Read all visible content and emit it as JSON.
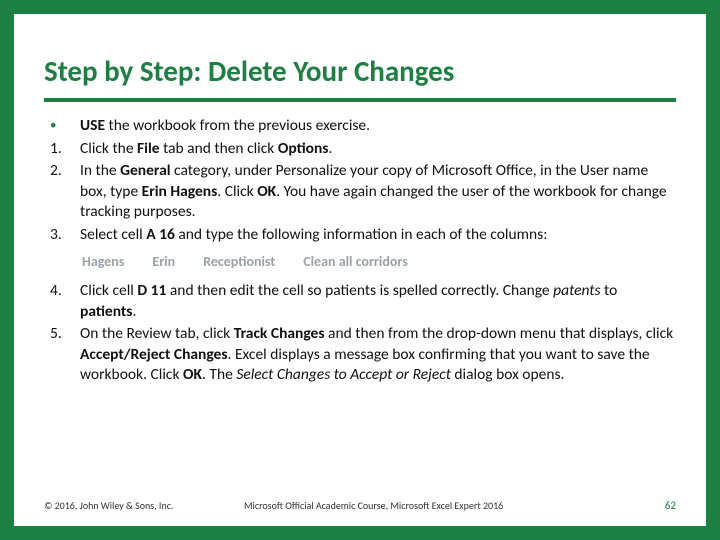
{
  "title": "Step by Step: Delete Your Changes",
  "intro_bold": "USE",
  "intro_rest": " the workbook from the previous exercise.",
  "steps": {
    "s1": {
      "num": "1.",
      "a": "Click the ",
      "b1": "File",
      "b": " tab and then click ",
      "b2": "Options",
      "c": "."
    },
    "s2": {
      "num": "2.",
      "a": "In the ",
      "b1": "General",
      "b": " category, under Personalize your copy of Microsoft Office, in the User name box, type ",
      "b2": "Erin Hagens",
      "c": ". Click ",
      "b3": "OK",
      "d": ". You have again changed the user of the workbook for change tracking purposes."
    },
    "s3": {
      "num": "3.",
      "a": "Select cell ",
      "b1": "A 16",
      "b": " and type the following information in each of the columns:"
    },
    "s4": {
      "num": "4.",
      "a": "Click cell ",
      "b1": "D 11",
      "b": " and then edit the cell so patients is spelled correctly. Change ",
      "i1": "patents",
      "c": " to ",
      "b2": "patients",
      "d": "."
    },
    "s5": {
      "num": "5.",
      "a": "On the Review tab, click ",
      "b1": "Track Changes",
      "b": " and then from the drop-down menu that displays, click ",
      "b2": "Accept/Reject Changes",
      "c": ". Excel displays a message box confirming that you want to save the workbook. Click ",
      "b3": "OK",
      "d": ". The ",
      "i1": "Select Changes to Accept or Reject",
      "e": " dialog box opens."
    }
  },
  "table_hint": {
    "c1": "Hagens",
    "c2": "Erin",
    "c3": "Receptionist",
    "c4": "Clean all corridors"
  },
  "footer": {
    "left": "© 2016, John Wiley & Sons, Inc.",
    "mid": "Microsoft Official Academic Course, Microsoft Excel Expert 2016",
    "page": "62"
  }
}
